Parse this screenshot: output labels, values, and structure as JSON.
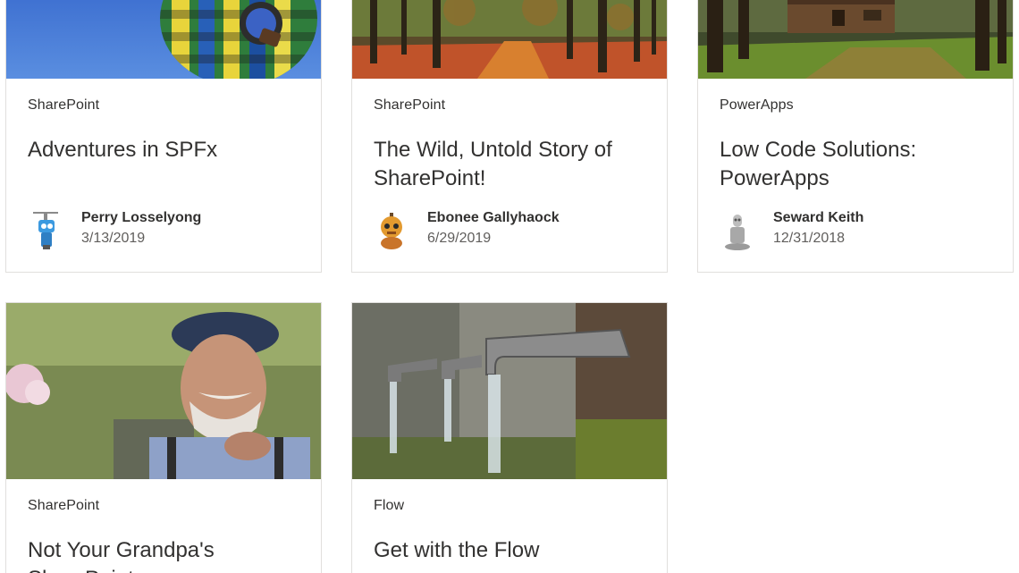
{
  "cards": [
    {
      "category": "SharePoint",
      "title": "Adventures in SPFx",
      "author": "Perry Losselyong",
      "date": "3/13/2019",
      "image": "hot-air-balloon"
    },
    {
      "category": "SharePoint",
      "title": "The Wild, Untold Story of SharePoint!",
      "author": "Ebonee Gallyhaock",
      "date": "6/29/2019",
      "image": "autumn-forest-path"
    },
    {
      "category": "PowerApps",
      "title": "Low Code Solutions: PowerApps",
      "author": "Seward Keith",
      "date": "12/31/2018",
      "image": "forest-cabin"
    },
    {
      "category": "SharePoint",
      "title": "Not Your Grandpa's SharePoint",
      "image": "old-man-with-cap"
    },
    {
      "category": "Flow",
      "title": "Get with the Flow",
      "image": "running-faucets"
    }
  ],
  "colors": {
    "text": "#323130",
    "secondary_text": "#605e5c",
    "border": "#e1dfdd"
  }
}
